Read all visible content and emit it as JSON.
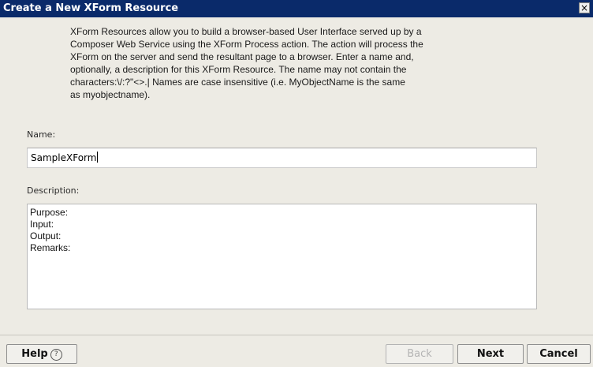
{
  "window": {
    "title": "Create a New XForm Resource",
    "close_glyph": "×"
  },
  "intro": {
    "lines": [
      "XForm Resources allow you to build a browser-based User Interface served up by a",
      "Composer Web Service using the XForm Process action. The action will process the",
      "XForm on the server and send the resultant page to a browser. Enter a name and,",
      "optionally, a description for this XForm Resource. The name may not contain the",
      "characters:\\/:?\"<>.|  Names are case insensitive (i.e. MyObjectName is the same",
      " as myobjectname)."
    ]
  },
  "name_field": {
    "label": "Name:",
    "value": "SampleXForm"
  },
  "description_field": {
    "label": "Description:",
    "lines": [
      "Purpose:",
      "Input:",
      "Output:",
      "Remarks:"
    ]
  },
  "buttons": {
    "help": "Help",
    "help_icon_glyph": "?",
    "back": "Back",
    "next": "Next",
    "cancel": "Cancel"
  }
}
